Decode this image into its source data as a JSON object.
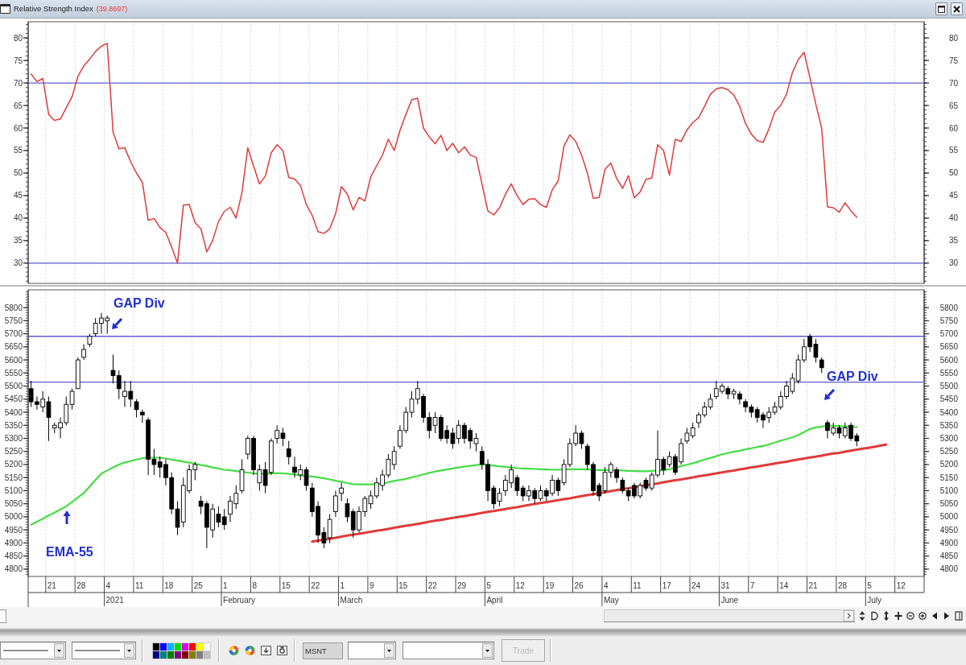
{
  "window": {
    "title": "Relative Strength Index",
    "reading": "(39.8697)"
  },
  "rsi_panel": {
    "left_scale": [
      "80",
      "75",
      "70",
      "65",
      "60",
      "55",
      "50",
      "45",
      "40",
      "35",
      "30"
    ],
    "chart_data": {
      "type": "line",
      "ylim": [
        25.5,
        83.6
      ],
      "yticks": [
        30,
        35,
        40,
        45,
        50,
        55,
        60,
        65,
        70,
        75,
        80
      ],
      "ref_lines": [
        {
          "axis": "y",
          "value": 70
        },
        {
          "axis": "y",
          "value": 30
        }
      ],
      "series": [
        {
          "color": "#e03a3a",
          "values": [
            72,
            70.3,
            71,
            63,
            61.7,
            62,
            64.5,
            67,
            71.5,
            73.8,
            75.3,
            77,
            78.2,
            78.8,
            59,
            55.4,
            55.6,
            52.5,
            50,
            47.9,
            39.5,
            39.9,
            37.9,
            36.8,
            33.6,
            30,
            42.9,
            43,
            39,
            37.6,
            32.5,
            35,
            39.2,
            41.5,
            42.4,
            40,
            45.6,
            55.6,
            51.5,
            47.6,
            49.3,
            54.5,
            56.3,
            55,
            49,
            48.7,
            47.2,
            43,
            40.6,
            37,
            36.6,
            37.6,
            41,
            47,
            45.3,
            41.8,
            44.6,
            43.8,
            49.2,
            51.6,
            54,
            57.5,
            55,
            59.5,
            63,
            66.3,
            66.6,
            60,
            58,
            56.5,
            58.4,
            55,
            56.6,
            54.5,
            55.8,
            54,
            53.5,
            47.5,
            41.6,
            40.7,
            42.3,
            45.3,
            47.6,
            45,
            43,
            44.2,
            44.3,
            43,
            42.4,
            46.3,
            48.2,
            56,
            58.5,
            57,
            54,
            50,
            44.4,
            44.6,
            50.8,
            52.2,
            48.8,
            46.6,
            49.4,
            44.5,
            45.8,
            48.6,
            48.9,
            56.3,
            55,
            49.5,
            57.5,
            57,
            59.6,
            61.2,
            62.3,
            64.8,
            67.5,
            68.7,
            69,
            68.5,
            67.3,
            64.8,
            61,
            58.6,
            57.2,
            56.8,
            59.8,
            63.6,
            65,
            67.5,
            72.3,
            75.2,
            76.8,
            71.2,
            65.3,
            60,
            42.5,
            42.3,
            41.3,
            43.4,
            41.6,
            40.2,
            null,
            null,
            null,
            null,
            null,
            null,
            null,
            null,
            null,
            null,
            null
          ]
        }
      ]
    }
  },
  "price_panel": {
    "left_scale": [
      "5800",
      "5750",
      "5700",
      "5650",
      "5600",
      "5550",
      "5500",
      "5450",
      "5400",
      "5350",
      "5300",
      "5250",
      "5200",
      "5150",
      "5100",
      "5050",
      "5000",
      "4950",
      "4900",
      "4850",
      "4800"
    ],
    "chart_data": {
      "type": "candlestick",
      "ylim": [
        4772,
        5868
      ],
      "yticks": [
        4800,
        4850,
        4900,
        4950,
        5000,
        5050,
        5100,
        5150,
        5200,
        5250,
        5300,
        5350,
        5400,
        5450,
        5500,
        5550,
        5600,
        5650,
        5700,
        5750,
        5800
      ],
      "ref_lines": [
        {
          "axis": "y",
          "value": 5690
        },
        {
          "axis": "y",
          "value": 5515
        }
      ],
      "series": [
        {
          "color": "#000000",
          "ohlc": [
            [
              5490,
              5520,
              5420,
              5440
            ],
            [
              5440,
              5460,
              5410,
              5430
            ],
            [
              5420,
              5480,
              5400,
              5450
            ],
            [
              5440,
              5460,
              5290,
              5380
            ],
            [
              5340,
              5360,
              5320,
              5350
            ],
            [
              5340,
              5380,
              5300,
              5360
            ],
            [
              5360,
              5460,
              5350,
              5430
            ],
            [
              5430,
              5490,
              5410,
              5480
            ],
            [
              5490,
              5610,
              5490,
              5600
            ],
            [
              5610,
              5660,
              5600,
              5640
            ],
            [
              5660,
              5700,
              5650,
              5690
            ],
            [
              5700,
              5760,
              5690,
              5740
            ],
            [
              5740,
              5780,
              5700,
              5760
            ],
            [
              5750,
              5770,
              5700,
              5760
            ],
            [
              5560,
              5620,
              5510,
              5540
            ],
            [
              5540,
              5560,
              5450,
              5490
            ],
            [
              5460,
              5520,
              5420,
              5480
            ],
            [
              5480,
              5520,
              5420,
              5450
            ],
            [
              5440,
              5450,
              5380,
              5410
            ],
            [
              5400,
              5410,
              5360,
              5390
            ],
            [
              5370,
              5380,
              5160,
              5220
            ],
            [
              5220,
              5260,
              5160,
              5200
            ],
            [
              5210,
              5230,
              5150,
              5190
            ],
            [
              5200,
              5220,
              5120,
              5150
            ],
            [
              5150,
              5170,
              5010,
              5030
            ],
            [
              5030,
              5060,
              4930,
              4960
            ],
            [
              4980,
              5150,
              4960,
              5120
            ],
            [
              5100,
              5200,
              5090,
              5180
            ],
            [
              5180,
              5210,
              5140,
              5200
            ],
            [
              5060,
              5080,
              5010,
              5040
            ],
            [
              5050,
              5060,
              4880,
              4960
            ],
            [
              4950,
              5050,
              4920,
              5030
            ],
            [
              5010,
              5040,
              4960,
              4980
            ],
            [
              5000,
              5030,
              4950,
              4970
            ],
            [
              5010,
              5080,
              4980,
              5060
            ],
            [
              5050,
              5120,
              5030,
              5090
            ],
            [
              5100,
              5220,
              5090,
              5180
            ],
            [
              5240,
              5310,
              5220,
              5300
            ],
            [
              5300,
              5310,
              5160,
              5180
            ],
            [
              5130,
              5200,
              5100,
              5180
            ],
            [
              5180,
              5210,
              5090,
              5120
            ],
            [
              5170,
              5300,
              5160,
              5290
            ],
            [
              5300,
              5350,
              5280,
              5330
            ],
            [
              5320,
              5340,
              5270,
              5300
            ],
            [
              5260,
              5290,
              5200,
              5230
            ],
            [
              5190,
              5230,
              5150,
              5170
            ],
            [
              5160,
              5200,
              5140,
              5180
            ],
            [
              5180,
              5190,
              5100,
              5120
            ],
            [
              5110,
              5130,
              5000,
              5020
            ],
            [
              5040,
              5060,
              4900,
              4930
            ],
            [
              4940,
              4960,
              4880,
              4900
            ],
            [
              4920,
              5010,
              4900,
              4990
            ],
            [
              5020,
              5100,
              5000,
              5080
            ],
            [
              5090,
              5130,
              5060,
              5110
            ],
            [
              5050,
              5070,
              4980,
              5000
            ],
            [
              5020,
              5030,
              4920,
              4950
            ],
            [
              4950,
              5040,
              4940,
              5020
            ],
            [
              5020,
              5080,
              5000,
              5070
            ],
            [
              5050,
              5100,
              5030,
              5080
            ],
            [
              5080,
              5150,
              5070,
              5130
            ],
            [
              5120,
              5180,
              5100,
              5160
            ],
            [
              5160,
              5240,
              5150,
              5220
            ],
            [
              5200,
              5270,
              5180,
              5250
            ],
            [
              5270,
              5350,
              5260,
              5330
            ],
            [
              5330,
              5420,
              5320,
              5400
            ],
            [
              5400,
              5480,
              5380,
              5450
            ],
            [
              5450,
              5520,
              5430,
              5490
            ],
            [
              5460,
              5470,
              5360,
              5380
            ],
            [
              5380,
              5400,
              5300,
              5330
            ],
            [
              5350,
              5400,
              5320,
              5380
            ],
            [
              5380,
              5390,
              5290,
              5300
            ],
            [
              5330,
              5350,
              5280,
              5300
            ],
            [
              5320,
              5340,
              5260,
              5280
            ],
            [
              5300,
              5370,
              5280,
              5350
            ],
            [
              5350,
              5360,
              5280,
              5300
            ],
            [
              5330,
              5340,
              5260,
              5290
            ],
            [
              5280,
              5320,
              5250,
              5300
            ],
            [
              5250,
              5270,
              5180,
              5200
            ],
            [
              5200,
              5220,
              5060,
              5100
            ],
            [
              5110,
              5120,
              5030,
              5050
            ],
            [
              5060,
              5110,
              5040,
              5090
            ],
            [
              5100,
              5160,
              5080,
              5140
            ],
            [
              5130,
              5200,
              5110,
              5180
            ],
            [
              5150,
              5160,
              5080,
              5100
            ],
            [
              5110,
              5120,
              5060,
              5080
            ],
            [
              5080,
              5120,
              5060,
              5100
            ],
            [
              5100,
              5110,
              5050,
              5070
            ],
            [
              5070,
              5120,
              5060,
              5100
            ],
            [
              5100,
              5110,
              5060,
              5080
            ],
            [
              5090,
              5160,
              5080,
              5140
            ],
            [
              5140,
              5150,
              5080,
              5100
            ],
            [
              5130,
              5220,
              5120,
              5200
            ],
            [
              5200,
              5300,
              5190,
              5280
            ],
            [
              5280,
              5350,
              5270,
              5320
            ],
            [
              5320,
              5330,
              5260,
              5280
            ],
            [
              5270,
              5280,
              5180,
              5200
            ],
            [
              5200,
              5210,
              5080,
              5100
            ],
            [
              5120,
              5130,
              5060,
              5080
            ],
            [
              5100,
              5190,
              5090,
              5170
            ],
            [
              5170,
              5210,
              5150,
              5200
            ],
            [
              5180,
              5190,
              5130,
              5150
            ],
            [
              5140,
              5150,
              5090,
              5100
            ],
            [
              5100,
              5110,
              5060,
              5080
            ],
            [
              5120,
              5130,
              5070,
              5080
            ],
            [
              5080,
              5130,
              5070,
              5120
            ],
            [
              5140,
              5150,
              5100,
              5110
            ],
            [
              5110,
              5170,
              5100,
              5160
            ],
            [
              5160,
              5330,
              5150,
              5220
            ],
            [
              5220,
              5230,
              5160,
              5180
            ],
            [
              5200,
              5250,
              5190,
              5230
            ],
            [
              5230,
              5240,
              5160,
              5170
            ],
            [
              5210,
              5300,
              5200,
              5280
            ],
            [
              5290,
              5340,
              5280,
              5320
            ],
            [
              5310,
              5360,
              5300,
              5340
            ],
            [
              5360,
              5400,
              5340,
              5390
            ],
            [
              5390,
              5440,
              5380,
              5420
            ],
            [
              5420,
              5470,
              5410,
              5450
            ],
            [
              5460,
              5520,
              5450,
              5490
            ],
            [
              5480,
              5510,
              5470,
              5500
            ],
            [
              5490,
              5500,
              5450,
              5470
            ],
            [
              5470,
              5490,
              5450,
              5480
            ],
            [
              5470,
              5480,
              5430,
              5450
            ],
            [
              5440,
              5450,
              5400,
              5420
            ],
            [
              5420,
              5430,
              5380,
              5400
            ],
            [
              5410,
              5420,
              5360,
              5380
            ],
            [
              5390,
              5400,
              5340,
              5370
            ],
            [
              5380,
              5420,
              5360,
              5400
            ],
            [
              5400,
              5440,
              5390,
              5420
            ],
            [
              5420,
              5480,
              5410,
              5460
            ],
            [
              5460,
              5520,
              5450,
              5500
            ],
            [
              5480,
              5550,
              5470,
              5530
            ],
            [
              5520,
              5620,
              5510,
              5600
            ],
            [
              5600,
              5680,
              5590,
              5650
            ],
            [
              5690,
              5700,
              5630,
              5650
            ],
            [
              5660,
              5680,
              5590,
              5610
            ],
            [
              5600,
              5610,
              5550,
              5570
            ],
            [
              5360,
              5370,
              5300,
              5330
            ],
            [
              5320,
              5360,
              5310,
              5340
            ],
            [
              5340,
              5350,
              5300,
              5320
            ],
            [
              5310,
              5360,
              5300,
              5340
            ],
            [
              5350,
              5360,
              5290,
              5300
            ],
            [
              5310,
              5320,
              5270,
              5290
            ],
            null,
            null,
            null,
            null,
            null,
            null,
            null,
            null,
            null,
            null,
            null
          ]
        },
        {
          "type": "line",
          "color": "#44dd44",
          "values": [
            4970,
            4981,
            4993,
            5005,
            5016,
            5028,
            5040,
            5057,
            5074,
            5091,
            5116,
            5141,
            5165,
            5177,
            5189,
            5200,
            5208,
            5213,
            5219,
            5224,
            5226,
            5226,
            5226,
            5223,
            5219,
            5215,
            5211,
            5207,
            5203,
            5198,
            5194,
            5189,
            5185,
            5180,
            5178,
            5175,
            5172,
            5169,
            5166,
            5164,
            5165,
            5166,
            5167,
            5166,
            5164,
            5162,
            5159,
            5156,
            5154,
            5151,
            5147,
            5143,
            5138,
            5134,
            5129,
            5125,
            5124,
            5124,
            5124,
            5125,
            5128,
            5132,
            5137,
            5141,
            5145,
            5151,
            5156,
            5162,
            5168,
            5173,
            5177,
            5181,
            5185,
            5189,
            5192,
            5195,
            5198,
            5201,
            5199,
            5196,
            5193,
            5191,
            5188,
            5186,
            5185,
            5184,
            5183,
            5182,
            5181,
            5180,
            5180,
            5181,
            5182,
            5182,
            5182,
            5181,
            5180,
            5179,
            5179,
            5179,
            5178,
            5177,
            5176,
            5175,
            5174,
            5174,
            5176,
            5177,
            5179,
            5182,
            5188,
            5194,
            5199,
            5205,
            5212,
            5219,
            5225,
            5232,
            5239,
            5244,
            5249,
            5253,
            5258,
            5262,
            5267,
            5271,
            5277,
            5284,
            5291,
            5297,
            5304,
            5313,
            5324,
            5336,
            5342,
            5345,
            5348,
            5348,
            5347,
            5345,
            5344,
            5343,
            null,
            null,
            null,
            null,
            null,
            null,
            null,
            null,
            null,
            null,
            null
          ]
        },
        {
          "type": "line",
          "color": "#e03b3b",
          "values": [
            null,
            null,
            null,
            null,
            null,
            null,
            null,
            null,
            null,
            null,
            null,
            null,
            null,
            null,
            null,
            null,
            null,
            null,
            null,
            null,
            null,
            null,
            null,
            null,
            null,
            null,
            null,
            null,
            null,
            null,
            null,
            null,
            null,
            null,
            null,
            null,
            null,
            null,
            null,
            null,
            null,
            null,
            null,
            null,
            null,
            null,
            null,
            null,
            4905,
            4909,
            4913,
            4916,
            4920,
            4924,
            4928,
            4932,
            4935,
            4939,
            4943,
            4947,
            4950,
            4954,
            4958,
            4962,
            4966,
            4969,
            4973,
            4977,
            4981,
            4985,
            4988,
            4992,
            4996,
            5000,
            5003,
            5007,
            5011,
            5015,
            5019,
            5022,
            5026,
            5030,
            5034,
            5037,
            5041,
            5045,
            5049,
            5053,
            5056,
            5060,
            5064,
            5068,
            5071,
            5075,
            5079,
            5083,
            5087,
            5090,
            5094,
            5098,
            5102,
            5106,
            5109,
            5113,
            5117,
            5121,
            5124,
            5128,
            5132,
            5136,
            5140,
            5143,
            5147,
            5151,
            5155,
            5158,
            5162,
            5166,
            5170,
            5174,
            5177,
            5181,
            5185,
            5189,
            5192,
            5196,
            5200,
            5204,
            5208,
            5211,
            5215,
            5219,
            5223,
            5227,
            5230,
            5234,
            5238,
            5242,
            5245,
            5249,
            5253,
            5257,
            5261,
            5264,
            5268,
            5272,
            5276,
            null,
            null,
            null,
            null,
            null,
            null
          ]
        }
      ],
      "annotations": [
        "GAP Div",
        "GAP Div",
        "EMA-55"
      ]
    }
  },
  "date_axis": [
    {
      "weeks": [
        "21",
        "28"
      ]
    },
    {
      "month": "2021",
      "weeks": [
        "4",
        "11",
        "18",
        "25"
      ]
    },
    {
      "month": "February",
      "weeks": [
        "1",
        "8",
        "15",
        "22"
      ]
    },
    {
      "month": "March",
      "weeks": [
        "1",
        "9",
        "15",
        "22",
        "29"
      ]
    },
    {
      "month": "April",
      "weeks": [
        "5",
        "12",
        "19",
        "26"
      ]
    },
    {
      "month": "May",
      "weeks": [
        "4",
        "11",
        "17",
        "24"
      ]
    },
    {
      "month": "June",
      "weeks": [
        "31",
        "7",
        "14",
        "21",
        "28"
      ]
    },
    {
      "month": "July",
      "weeks": [
        "5",
        "12"
      ]
    }
  ],
  "toolbar": {
    "palette": [
      {
        "color": "#000000"
      },
      {
        "color": "#0000ff"
      },
      {
        "color": "#00b4ff"
      },
      {
        "color": "#00e000"
      },
      {
        "color": "#e000e0"
      },
      {
        "color": "#ff0000"
      },
      {
        "color": "#ffff00"
      },
      {
        "color": "#ffffff"
      },
      {
        "color": "#000080"
      },
      {
        "color": "#008080"
      },
      {
        "color": "#008000"
      },
      {
        "color": "#800080"
      },
      {
        "color": "#800000"
      },
      {
        "color": "#808000"
      },
      {
        "color": "#808080"
      },
      {
        "color": "#c0c0c0"
      }
    ],
    "symbol": "MSNT",
    "trade_button": {
      "label": "Trade",
      "disabled": true
    }
  }
}
